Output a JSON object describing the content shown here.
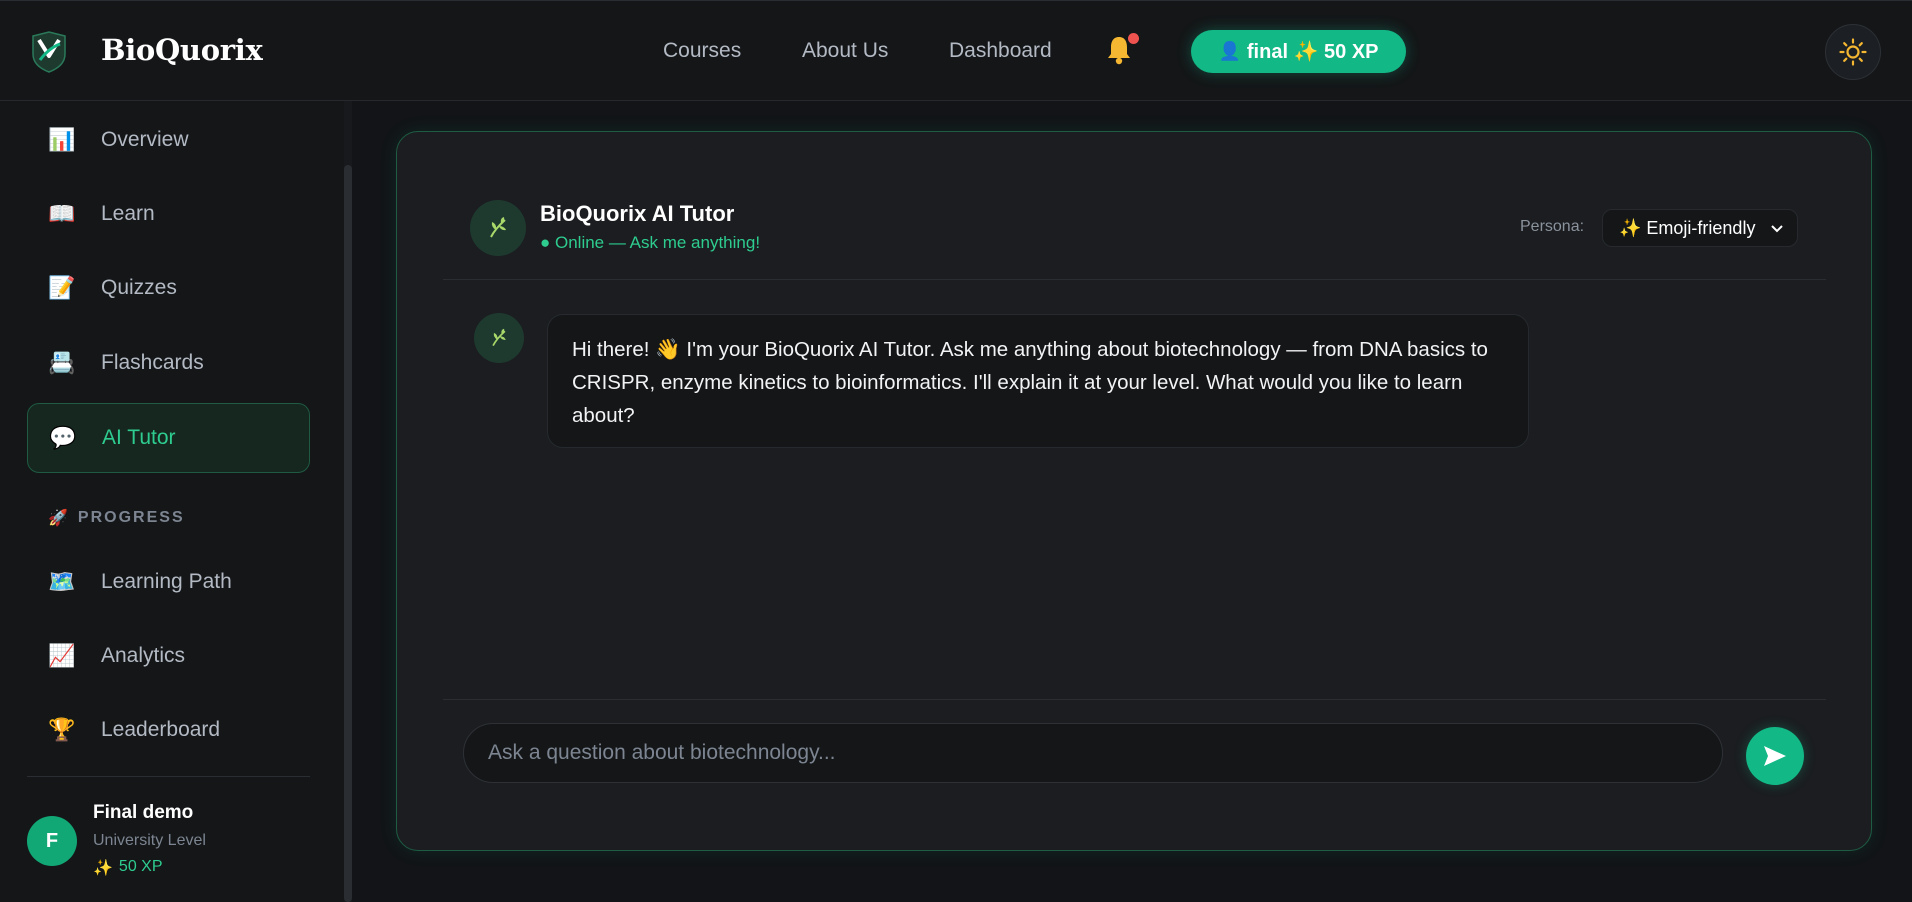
{
  "brand": {
    "name": "BioQuorix"
  },
  "topnav": {
    "links": [
      "Courses",
      "About Us",
      "Dashboard"
    ],
    "xp_pill": "final ✨ 50 XP",
    "notification_dot_color": "#ef5350"
  },
  "sidebar": {
    "items": [
      {
        "label": "Overview",
        "icon": "bar-chart-icon",
        "glyph": "📊"
      },
      {
        "label": "Learn",
        "icon": "open-book-icon",
        "glyph": "📖"
      },
      {
        "label": "Quizzes",
        "icon": "memo-icon",
        "glyph": "📝"
      },
      {
        "label": "Flashcards",
        "icon": "card-index-icon",
        "glyph": "📇"
      },
      {
        "label": "AI Tutor",
        "icon": "speech-bubble-icon",
        "glyph": "💬",
        "active": true
      }
    ],
    "section_label": "PROGRESS",
    "section_glyph": "🚀",
    "progress_items": [
      {
        "label": "Learning Path",
        "icon": "map-icon",
        "glyph": "🗺️"
      },
      {
        "label": "Analytics",
        "icon": "trend-chart-icon",
        "glyph": "📈"
      },
      {
        "label": "Leaderboard",
        "icon": "trophy-icon",
        "glyph": "🏆"
      }
    ],
    "user": {
      "initial": "F",
      "name": "Final demo",
      "level": "University Level",
      "xp": "50 XP",
      "xp_glyph": "✨"
    }
  },
  "chat": {
    "title": "BioQuorix AI Tutor",
    "status": "● Online — Ask me anything!",
    "persona_label": "Persona:",
    "persona_value": "✨ Emoji-friendly",
    "messages": [
      {
        "role": "assistant",
        "text": "Hi there! 👋 I'm your BioQuorix AI Tutor. Ask me anything about biotechnology — from DNA basics to CRISPR, enzyme kinetics to bioinformatics. I'll explain it at your level. What would you like to learn about?"
      }
    ],
    "input_placeholder": "Ask a question about biotechnology..."
  },
  "colors": {
    "accent": "#12b886",
    "accent_text": "#2ecc8f",
    "background": "#121417",
    "panel": "#1b1d20"
  }
}
